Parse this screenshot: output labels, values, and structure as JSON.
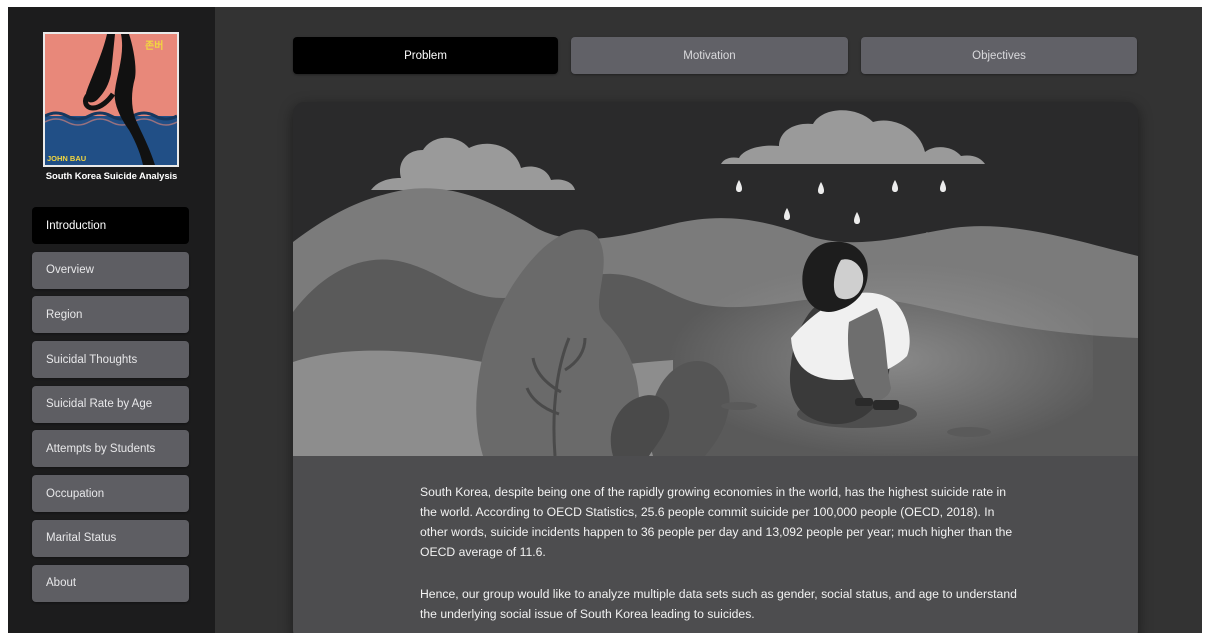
{
  "sidebar": {
    "logo": {
      "badge_text": "존버",
      "name_text": "JOHN BAU",
      "colors": {
        "top": "#e8887a",
        "bottom": "#214f86",
        "badge": "#f2d640"
      }
    },
    "caption": "South Korea Suicide Analysis",
    "items": [
      {
        "label": "Introduction",
        "active": true
      },
      {
        "label": "Overview",
        "active": false
      },
      {
        "label": "Region",
        "active": false
      },
      {
        "label": "Suicidal Thoughts",
        "active": false
      },
      {
        "label": "Suicidal Rate by Age",
        "active": false
      },
      {
        "label": "Attempts by Students",
        "active": false
      },
      {
        "label": "Occupation",
        "active": false
      },
      {
        "label": "Marital Status",
        "active": false
      },
      {
        "label": "About",
        "active": false
      }
    ]
  },
  "tabs": [
    {
      "label": "Problem",
      "active": true
    },
    {
      "label": "Motivation",
      "active": false
    },
    {
      "label": "Objectives",
      "active": false
    }
  ],
  "content": {
    "paragraph1": "South Korea, despite being one of the rapidly growing economies in the world, has the highest suicide rate in the world. According to OECD Statistics, 25.6 people commit suicide per 100,000 people (OECD, 2018). In other words, suicide incidents happen to 36 people per day and 13,092 people per year; much higher than the OECD average of 11.6.",
    "paragraph2": "Hence, our group would like to analyze multiple data sets such as gender, social status, and age to understand the underlying social issue of South Korea leading to suicides."
  },
  "colors": {
    "page_background": "#333333",
    "sidebar_background": "#1c1c1d",
    "button_background": "#5e5e63",
    "active_background": "#000000",
    "text_panel": "#4d4d4f"
  }
}
